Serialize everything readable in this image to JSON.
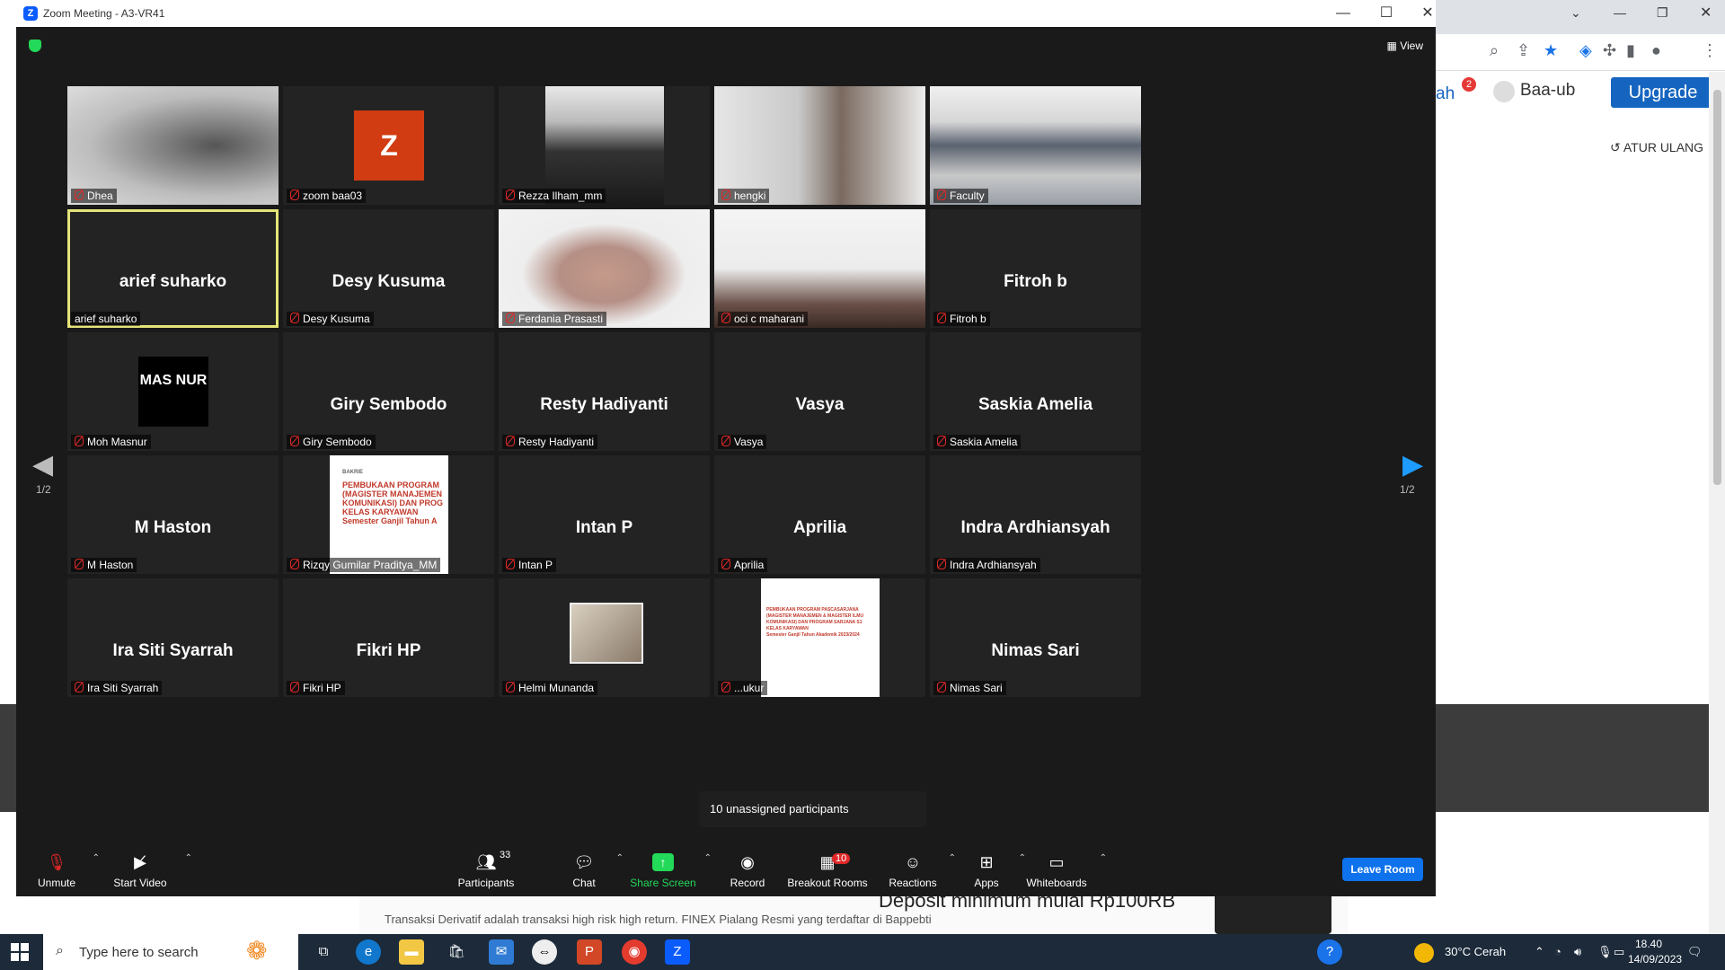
{
  "window": {
    "title": "Zoom Meeting - A3-VR41",
    "app_icon_glyph": "Z",
    "min_glyph": "—",
    "max_glyph": "☐",
    "close_glyph": "✕"
  },
  "meeting": {
    "view_label": "View",
    "page_left": "1/2",
    "page_right": "1/2",
    "tooltip": "10 unassigned participants"
  },
  "tiles": [
    {
      "name": "Dhea",
      "big": ""
    },
    {
      "name": "zoom baa03",
      "big": ""
    },
    {
      "name": "Rezza Ilham_mm",
      "big": ""
    },
    {
      "name": "hengki",
      "big": ""
    },
    {
      "name": "Faculty",
      "big": ""
    },
    {
      "name": "arief suharko",
      "big": "arief suharko"
    },
    {
      "name": "Desy Kusuma",
      "big": "Desy Kusuma"
    },
    {
      "name": "Ferdania Prasasti",
      "big": ""
    },
    {
      "name": "oci c maharani",
      "big": ""
    },
    {
      "name": "Fitroh b",
      "big": "Fitroh b"
    },
    {
      "name": "Moh Masnur",
      "big": ""
    },
    {
      "name": "Giry Sembodo",
      "big": "Giry Sembodo"
    },
    {
      "name": "Resty Hadiyanti",
      "big": "Resty Hadiyanti"
    },
    {
      "name": "Vasya",
      "big": "Vasya"
    },
    {
      "name": "Saskia Amelia",
      "big": "Saskia Amelia"
    },
    {
      "name": "M Haston",
      "big": "M Haston"
    },
    {
      "name": "Rizqy Gumilar Praditya_MM",
      "big": ""
    },
    {
      "name": "Intan P",
      "big": "Intan P"
    },
    {
      "name": "Aprilia",
      "big": "Aprilia"
    },
    {
      "name": "Indra Ardhiansyah",
      "big": "Indra Ardhiansyah"
    },
    {
      "name": "Ira Siti Syarrah",
      "big": "Ira Siti Syarrah"
    },
    {
      "name": "Fikri HP",
      "big": "Fikri HP"
    },
    {
      "name": "Helmi Munanda",
      "big": ""
    },
    {
      "name": "...ukur",
      "big": ""
    },
    {
      "name": "Nimas Sari",
      "big": "Nimas Sari"
    }
  ],
  "avatars": {
    "zoom_baa03_letter": "Z",
    "masnur_logo": "MAS NUR"
  },
  "slides": {
    "brand": "BAKRIE",
    "rizqy_lines": [
      "PEMBUKAAN PROGRAM",
      "(MAGISTER MANAJEMEN",
      "KOMUNIKASI) DAN PROG",
      "KELAS KARYAWAN",
      "Semester Ganjil Tahun A"
    ],
    "second_lines": [
      "PEMBUKAAN PROGRAM PASCASARJANA",
      "(MAGISTER MANAJEMEN & MAGISTER ILMU",
      "KOMUNIKASI) DAN PROGRAM SARJANA S1",
      "KELAS KARYAWAN",
      "Semester Ganjil Tahun Akademik 2023/2024"
    ]
  },
  "toolbar": {
    "unmute": "Unmute",
    "start_video": "Start Video",
    "participants": "Participants",
    "participants_count": "33",
    "chat": "Chat",
    "share_screen": "Share Screen",
    "record": "Record",
    "breakout_rooms": "Breakout Rooms",
    "breakout_badge": "10",
    "reactions": "Reactions",
    "apps": "Apps",
    "whiteboards": "Whiteboards",
    "leave_room": "Leave Room"
  },
  "background_page": {
    "nav_fragment": "ah",
    "notif_count": "2",
    "user": "Baa-ub",
    "upgrade": "Upgrade",
    "reset": "ATUR ULANG",
    "ad_title": "Deposit minimum mulai Rp100RB",
    "ad_text": "Transaksi Derivatif adalah transaksi high risk high return. FINEX Pialang Resmi yang terdaftar di Bappebti"
  },
  "taskbar": {
    "search_placeholder": "Type here to search",
    "weather": "30°C  Cerah",
    "time": "18.40",
    "date": "14/09/2023"
  },
  "colors": {
    "zoom_blue": "#0e72ed",
    "share_green": "#23d959",
    "mic_red": "#e02828",
    "active_outline": "#e4e47a",
    "avatar_orange": "#d13c12"
  }
}
